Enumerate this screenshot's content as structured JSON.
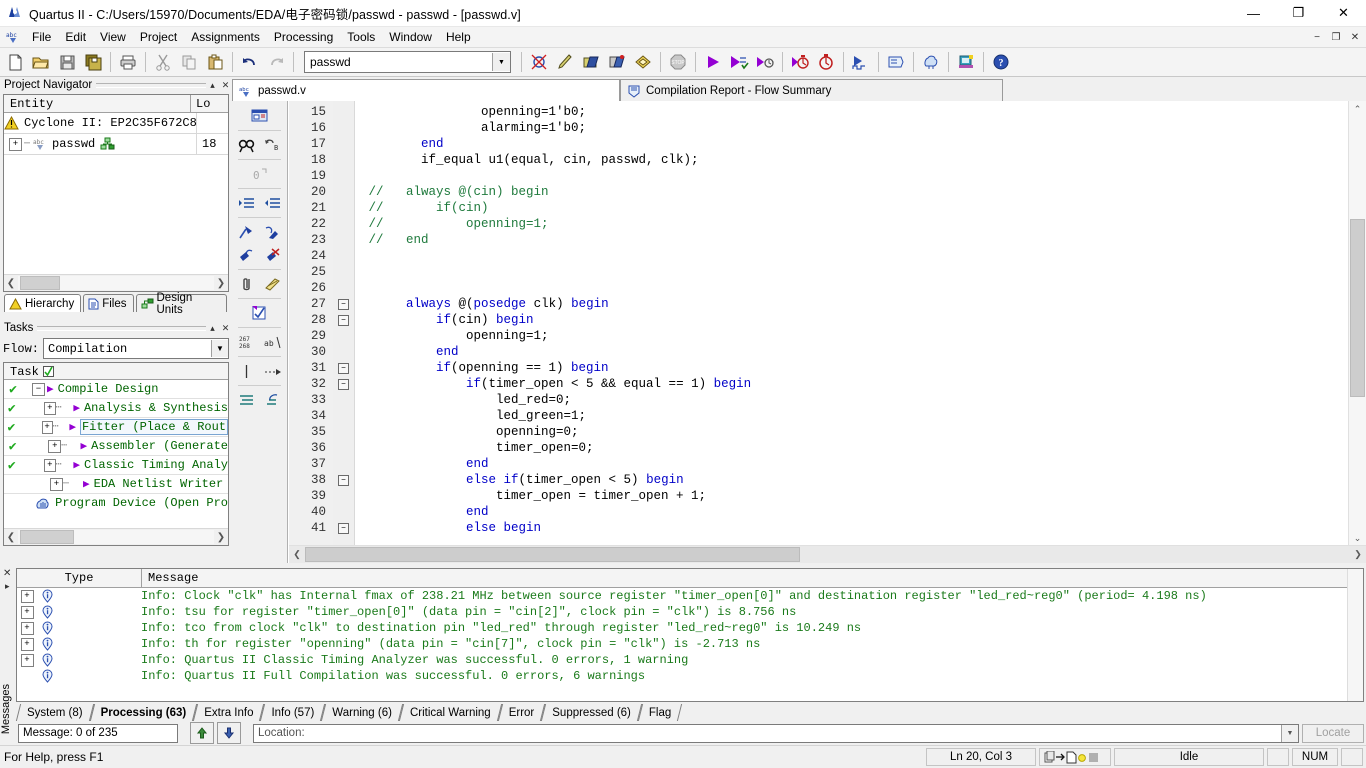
{
  "window": {
    "title": "Quartus II - C:/Users/15970/Documents/EDA/电子密码锁/passwd - passwd - [passwd.v]",
    "minimize": "—",
    "maximize": "❐",
    "close": "✕"
  },
  "mdi": {
    "minimize": "−",
    "restore": "❐",
    "close": "✕"
  },
  "menu": {
    "items": [
      "File",
      "Edit",
      "View",
      "Project",
      "Assignments",
      "Processing",
      "Tools",
      "Window",
      "Help"
    ]
  },
  "toolbar": {
    "buttons": [
      "new-file-icon",
      "open-file-icon",
      "save-icon",
      "save-all-icon",
      "print-icon",
      "cut-icon",
      "copy-icon",
      "paste-icon",
      "undo-icon",
      "redo-icon"
    ],
    "project_combo": {
      "value": "passwd"
    },
    "right_buttons": [
      "compiler-tool-icon",
      "analysis-synthesis-icon",
      "fitter-icon",
      "assembler-icon",
      "timing-analyzer-icon",
      "stop-icon",
      "start-compilation-icon",
      "start-analysis-elaboration-icon",
      "start-timing-icon",
      "timing-analyzer-tool-icon",
      "classic-timing-icon",
      "programmer-icon",
      "rtl-viewer-icon",
      "chip-planner-icon",
      "pin-planner-icon",
      "help-icon"
    ]
  },
  "project_navigator": {
    "title": "Project Navigator",
    "collapse": "▴",
    "close": "✕",
    "columns": [
      "Entity",
      "Lo"
    ],
    "rows": [
      {
        "icon": "device-warning-icon",
        "label": "Cyclone II: EP2C35F672C8",
        "lo": ""
      },
      {
        "icon": "verilog-file-icon",
        "label": "passwd",
        "lo": "18",
        "expander": "+"
      }
    ],
    "tabs": [
      {
        "label": "Hierarchy",
        "icon": "hierarchy-icon",
        "active": true
      },
      {
        "label": "Files",
        "icon": "files-icon",
        "active": false
      },
      {
        "label": "Design Units",
        "icon": "design-units-icon",
        "active": false
      }
    ]
  },
  "tasks": {
    "title": "Tasks",
    "collapse": "▴",
    "close": "✕",
    "flow_label": "Flow:",
    "flow_value": "Compilation",
    "column_header": "Task",
    "rows": [
      {
        "check": "✔",
        "expander": "−",
        "label": "Compile Design",
        "indent": 0,
        "triangle": "▶",
        "selected": false
      },
      {
        "check": "✔",
        "expander": "+",
        "label": "Analysis & Synthesis",
        "indent": 1,
        "triangle": "▶",
        "selected": false
      },
      {
        "check": "✔",
        "expander": "+",
        "label": "Fitter (Place & Rout",
        "indent": 1,
        "triangle": "▶",
        "selected": true
      },
      {
        "check": "✔",
        "expander": "+",
        "label": "Assembler (Generate",
        "indent": 1,
        "triangle": "▶",
        "selected": false
      },
      {
        "check": "✔",
        "expander": "+",
        "label": "Classic Timing Analy",
        "indent": 1,
        "triangle": "▶",
        "selected": false
      },
      {
        "check": "",
        "expander": "+",
        "label": "EDA Netlist Writer",
        "indent": 1,
        "triangle": "▶",
        "selected": false
      },
      {
        "check": "",
        "expander": "",
        "label": "Program Device (Open Pro",
        "indent": 1,
        "triangle": "",
        "selected": false
      }
    ]
  },
  "document_tabs": [
    {
      "label": "passwd.v",
      "icon": "verilog-file-icon",
      "active": true
    },
    {
      "label": "Compilation Report - Flow Summary",
      "icon": "report-icon",
      "active": false
    }
  ],
  "vertical_toolbar": [
    [
      "insert-template-icon"
    ],
    [
      "find-icon",
      "find-replace-icon"
    ],
    [
      "goto-line-icon"
    ],
    [
      "increase-indent-icon",
      "decrease-indent-icon"
    ],
    [
      "bookmark-toggle-icon",
      "bookmark-next-icon"
    ],
    [
      "bookmark-prev-icon",
      "bookmark-clear-icon"
    ],
    [
      "attach-icon",
      "comment-icon"
    ],
    [
      "check-syntax-icon"
    ],
    [
      "line-numbers-icon",
      "word-wrap-icon"
    ],
    [
      "column-select-icon",
      "indent-guide-icon"
    ],
    [
      "align-icon",
      "undo-edit-icon"
    ]
  ],
  "editor": {
    "first_line": 15,
    "lines": [
      {
        "n": 15,
        "fold": "",
        "segments": [
          {
            "t": "                openning=1'b0;",
            "c": "pl"
          }
        ]
      },
      {
        "n": 16,
        "fold": "",
        "segments": [
          {
            "t": "                alarming=1'b0;",
            "c": "pl"
          }
        ]
      },
      {
        "n": 17,
        "fold": "",
        "segments": [
          {
            "t": "        ",
            "c": "pl"
          },
          {
            "t": "end",
            "c": "kw"
          }
        ]
      },
      {
        "n": 18,
        "fold": "",
        "segments": [
          {
            "t": "        if_equal u1(equal, cin, passwd, clk);",
            "c": "pl"
          }
        ]
      },
      {
        "n": 19,
        "fold": "",
        "segments": [
          {
            "t": "",
            "c": "pl"
          }
        ]
      },
      {
        "n": 20,
        "fold": "",
        "segments": [
          {
            "t": " //   always @(cin) begin",
            "c": "cm"
          }
        ]
      },
      {
        "n": 21,
        "fold": "",
        "segments": [
          {
            "t": " //       if(cin)",
            "c": "cm"
          }
        ]
      },
      {
        "n": 22,
        "fold": "",
        "segments": [
          {
            "t": " //           openning=1;",
            "c": "cm"
          }
        ]
      },
      {
        "n": 23,
        "fold": "",
        "segments": [
          {
            "t": " //   end",
            "c": "cm"
          }
        ]
      },
      {
        "n": 24,
        "fold": "",
        "segments": [
          {
            "t": "",
            "c": "pl"
          }
        ]
      },
      {
        "n": 25,
        "fold": "",
        "segments": [
          {
            "t": "",
            "c": "pl"
          }
        ]
      },
      {
        "n": 26,
        "fold": "",
        "segments": [
          {
            "t": "",
            "c": "pl"
          }
        ]
      },
      {
        "n": 27,
        "fold": "−",
        "segments": [
          {
            "t": "      always ",
            "c": "kw"
          },
          {
            "t": "@(",
            "c": "pl"
          },
          {
            "t": "posedge",
            "c": "kw"
          },
          {
            "t": " clk) ",
            "c": "pl"
          },
          {
            "t": "begin",
            "c": "kw"
          }
        ]
      },
      {
        "n": 28,
        "fold": "−",
        "segments": [
          {
            "t": "          if",
            "c": "kw"
          },
          {
            "t": "(cin) ",
            "c": "pl"
          },
          {
            "t": "begin",
            "c": "kw"
          }
        ]
      },
      {
        "n": 29,
        "fold": "",
        "segments": [
          {
            "t": "              openning=1;",
            "c": "pl"
          }
        ]
      },
      {
        "n": 30,
        "fold": "",
        "segments": [
          {
            "t": "          ",
            "c": "pl"
          },
          {
            "t": "end",
            "c": "kw"
          }
        ]
      },
      {
        "n": 31,
        "fold": "−",
        "segments": [
          {
            "t": "          if",
            "c": "kw"
          },
          {
            "t": "(openning == 1) ",
            "c": "pl"
          },
          {
            "t": "begin",
            "c": "kw"
          }
        ]
      },
      {
        "n": 32,
        "fold": "−",
        "segments": [
          {
            "t": "              if",
            "c": "kw"
          },
          {
            "t": "(timer_open < 5 && equal == 1) ",
            "c": "pl"
          },
          {
            "t": "begin",
            "c": "kw"
          }
        ]
      },
      {
        "n": 33,
        "fold": "",
        "segments": [
          {
            "t": "                  led_red=0;",
            "c": "pl"
          }
        ]
      },
      {
        "n": 34,
        "fold": "",
        "segments": [
          {
            "t": "                  led_green=1;",
            "c": "pl"
          }
        ]
      },
      {
        "n": 35,
        "fold": "",
        "segments": [
          {
            "t": "                  openning=0;",
            "c": "pl"
          }
        ]
      },
      {
        "n": 36,
        "fold": "",
        "segments": [
          {
            "t": "                  timer_open=0;",
            "c": "pl"
          }
        ]
      },
      {
        "n": 37,
        "fold": "",
        "segments": [
          {
            "t": "              ",
            "c": "pl"
          },
          {
            "t": "end",
            "c": "kw"
          }
        ]
      },
      {
        "n": 38,
        "fold": "−",
        "segments": [
          {
            "t": "              else if",
            "c": "kw"
          },
          {
            "t": "(timer_open < 5) ",
            "c": "pl"
          },
          {
            "t": "begin",
            "c": "kw"
          }
        ]
      },
      {
        "n": 39,
        "fold": "",
        "segments": [
          {
            "t": "                  timer_open = timer_open + 1;",
            "c": "pl"
          }
        ]
      },
      {
        "n": 40,
        "fold": "",
        "segments": [
          {
            "t": "              ",
            "c": "pl"
          },
          {
            "t": "end",
            "c": "kw"
          }
        ]
      },
      {
        "n": 41,
        "fold": "−",
        "segments": [
          {
            "t": "              else begin",
            "c": "kw"
          }
        ]
      }
    ]
  },
  "messages": {
    "vertical_label": "Messages",
    "close": "✕",
    "pin": "▸",
    "columns": [
      "Type",
      "Message"
    ],
    "rows": [
      {
        "expand": "+",
        "icon": "info-icon",
        "text": "Info: Clock \"clk\" has Internal fmax of 238.21 MHz between source register \"timer_open[0]\" and destination register \"led_red~reg0\"  (period= 4.198 ns)"
      },
      {
        "expand": "+",
        "icon": "info-icon",
        "text": "Info: tsu for register \"timer_open[0]\" (data pin = \"cin[2]\", clock pin = \"clk\") is 8.756 ns"
      },
      {
        "expand": "+",
        "icon": "info-icon",
        "text": "Info: tco from clock \"clk\" to destination pin \"led_red\" through register \"led_red~reg0\" is 10.249 ns"
      },
      {
        "expand": "+",
        "icon": "info-icon",
        "text": "Info: th for register \"openning\" (data pin = \"cin[7]\", clock pin = \"clk\") is -2.713 ns"
      },
      {
        "expand": "+",
        "icon": "info-icon",
        "text": "Info: Quartus II Classic Timing Analyzer was successful. 0 errors, 1 warning"
      },
      {
        "expand": "",
        "icon": "info-icon",
        "text": "Info: Quartus II Full Compilation was successful. 0 errors, 6 warnings"
      }
    ],
    "tabs": [
      {
        "label": "System (8)",
        "active": false
      },
      {
        "label": "Processing (63)",
        "active": true
      },
      {
        "label": "Extra Info",
        "active": false
      },
      {
        "label": "Info (57)",
        "active": false
      },
      {
        "label": "Warning (6)",
        "active": false
      },
      {
        "label": "Critical Warning",
        "active": false
      },
      {
        "label": "Error",
        "active": false
      },
      {
        "label": "Suppressed (6)",
        "active": false
      },
      {
        "label": "Flag",
        "active": false
      }
    ],
    "counter": "Message: 0 of 235",
    "up_button": "up-arrow-icon",
    "down_button": "down-arrow-icon",
    "location_label": "Location:",
    "locate_button": "Locate"
  },
  "statusbar": {
    "help": "For Help, press F1",
    "cursor": "Ln 20, Col 3",
    "state": "Idle",
    "num": "NUM"
  },
  "colors": {
    "keyword": "#0000c8",
    "comment": "#1f7a3d",
    "message_text": "#1a7a1a",
    "task_label": "#006400",
    "check": "#1faa1f",
    "triangle": "#9400d3"
  }
}
